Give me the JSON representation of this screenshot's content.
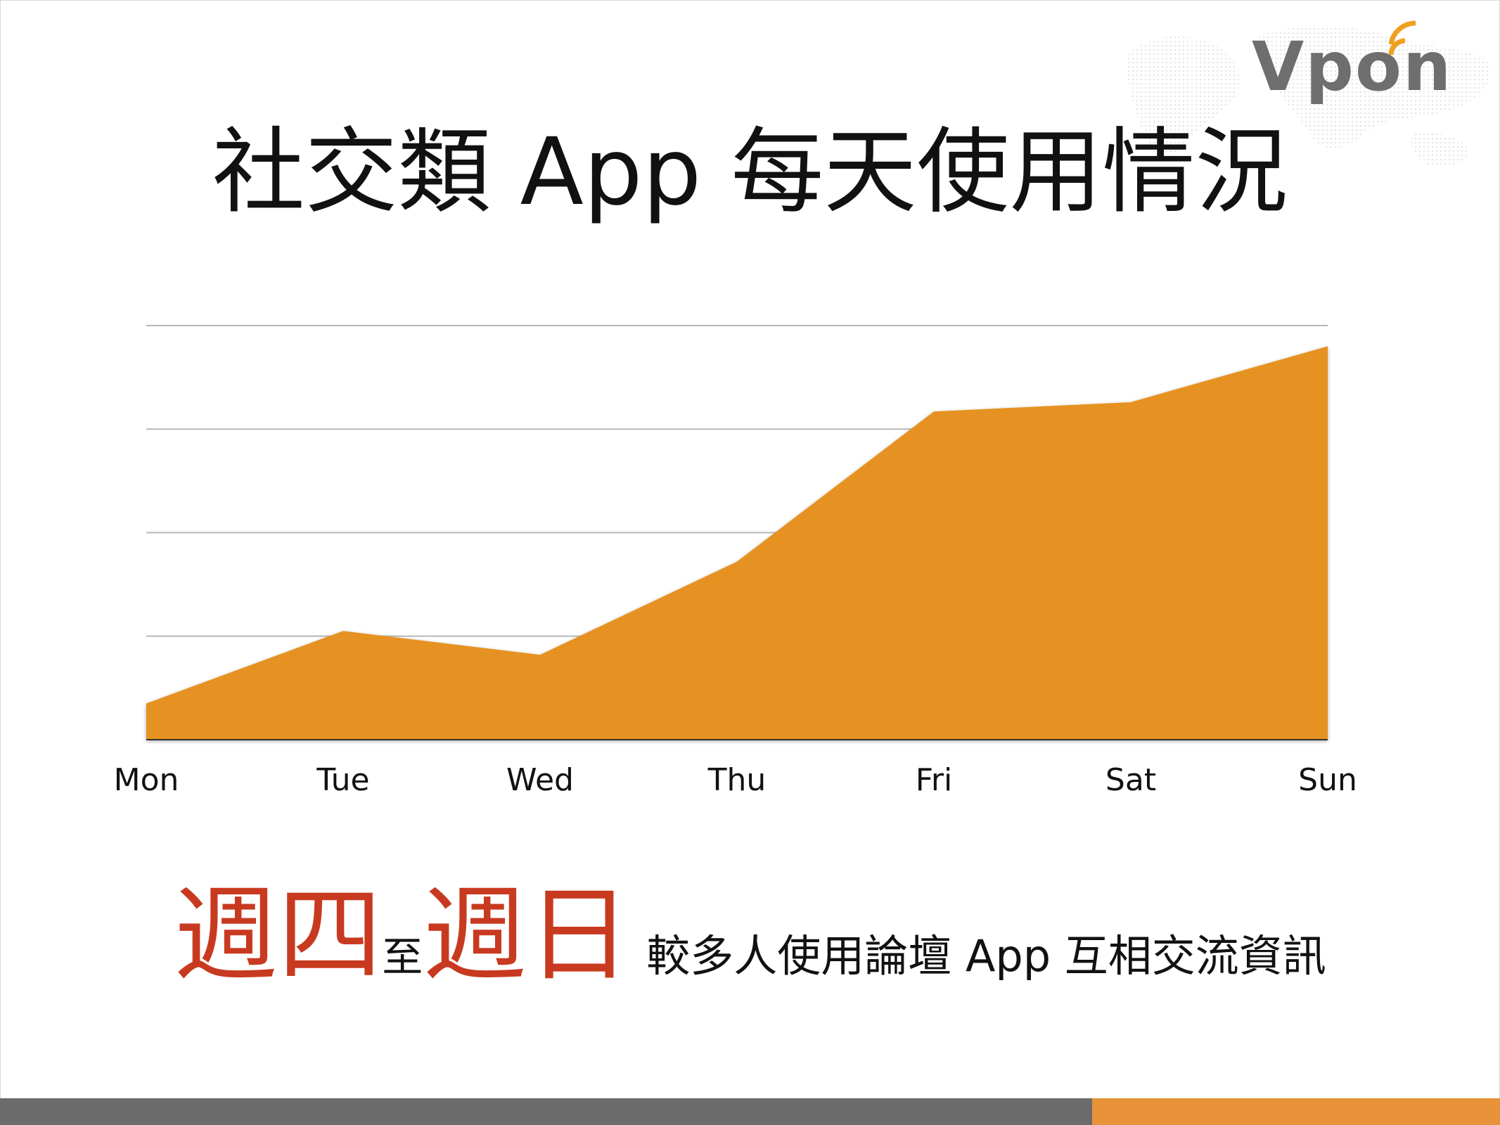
{
  "logo": {
    "text": "Vpon"
  },
  "slide": {
    "title": "社交類 App 每天使用情況"
  },
  "caption": {
    "highlight_1": "週四",
    "connector": "至",
    "highlight_2": "週日",
    "rest": "較多人使用論壇 App 互相交流資訊"
  },
  "colors": {
    "area_fill": "#e69222",
    "highlight_text": "#c83a20",
    "grid": "#b8b8b8",
    "bar_gray": "#6b6b6b",
    "bar_orange": "#e8923a"
  },
  "chart_data": {
    "type": "area",
    "title": "",
    "xlabel": "",
    "ylabel": "",
    "categories": [
      "Mon",
      "Tue",
      "Wed",
      "Thu",
      "Fri",
      "Sat",
      "Sun"
    ],
    "series": [
      {
        "values": [
          0.35,
          1.05,
          0.82,
          1.72,
          3.17,
          3.26,
          3.8
        ]
      }
    ],
    "ylim": [
      0,
      4
    ],
    "grid": true,
    "y_tick_labels_visible": false,
    "legend": "none"
  }
}
